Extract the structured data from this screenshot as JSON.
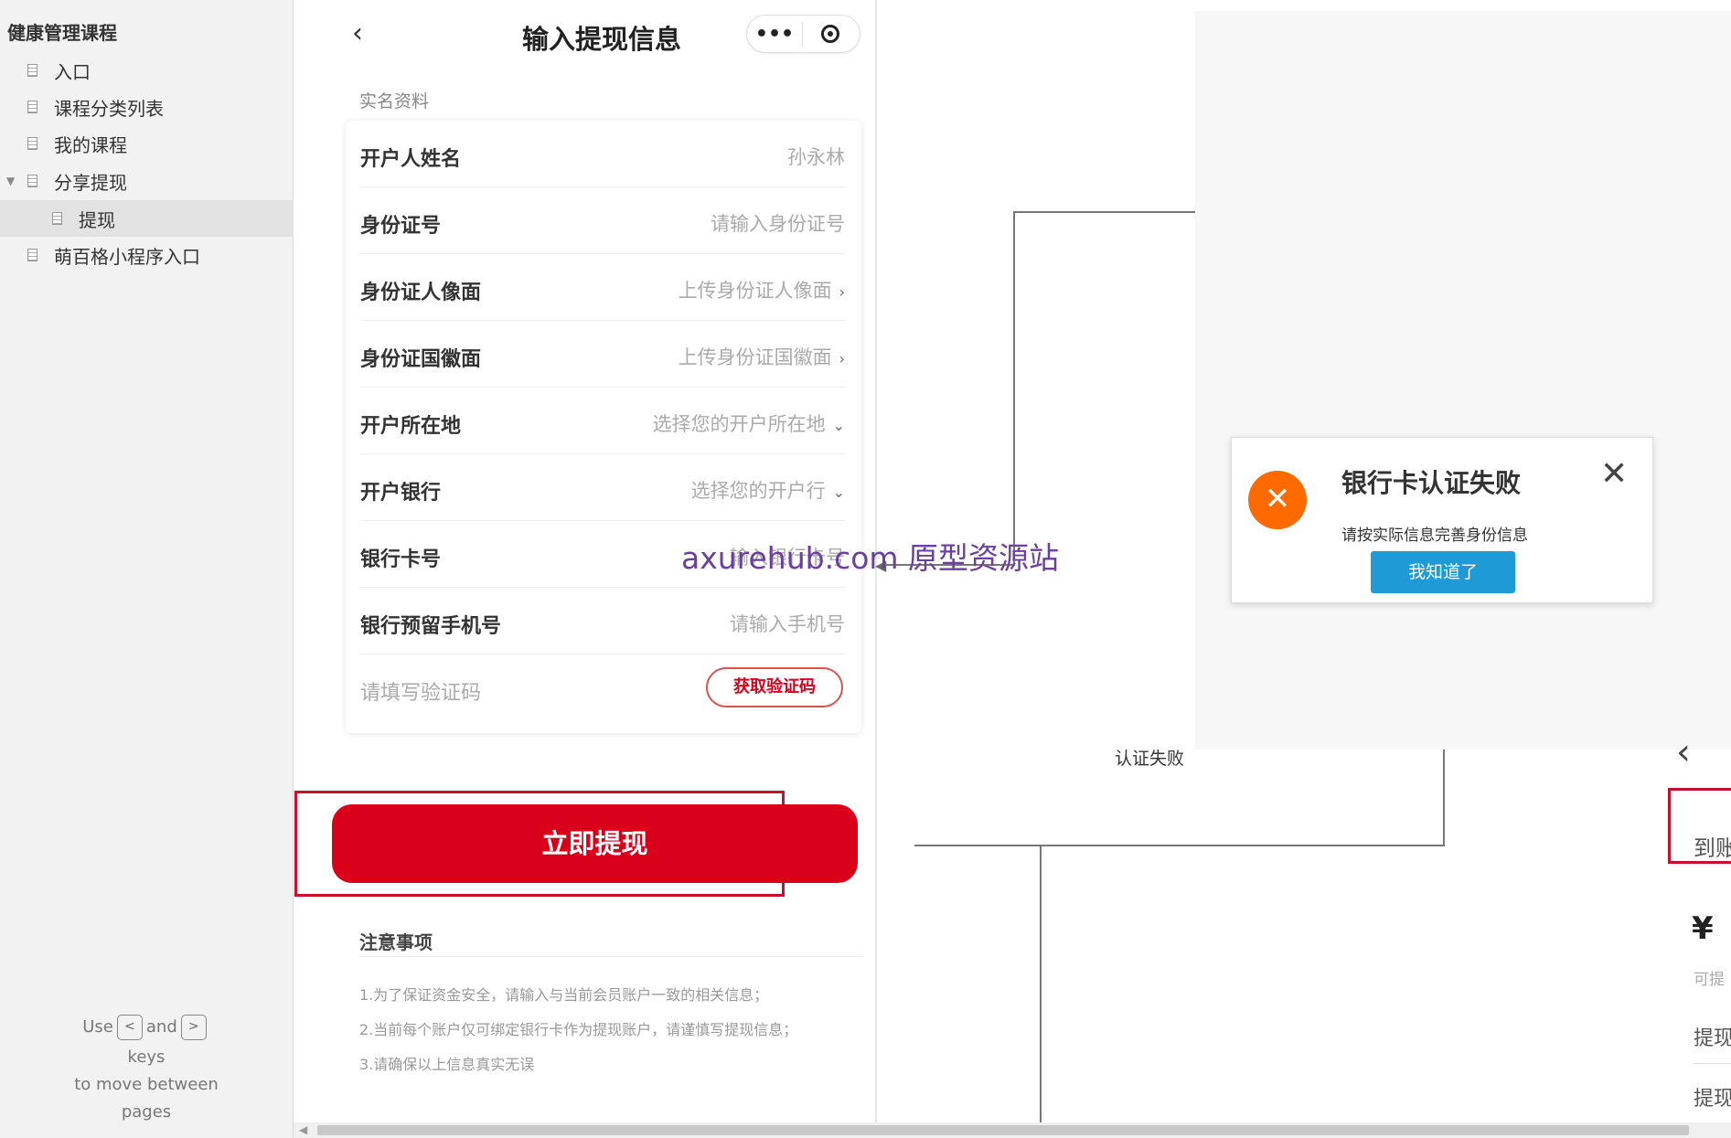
{
  "sidebar": {
    "project_title": "健康管理课程",
    "items": [
      {
        "label": "入口"
      },
      {
        "label": "课程分类列表"
      },
      {
        "label": "我的课程"
      },
      {
        "label": "分享提现",
        "expanded": true
      },
      {
        "label": "提现",
        "selected": true
      },
      {
        "label": "萌百格小程序入口"
      }
    ],
    "hint": {
      "use": "Use",
      "and": "and",
      "keys": "keys",
      "line2": "to move between",
      "line3": "pages",
      "prev_key": "<",
      "next_key": ">"
    }
  },
  "phone": {
    "title": "输入提现信息",
    "capsule_more": "•••",
    "section_label": "实名资料",
    "fields": [
      {
        "label": "开户人姓名",
        "value": "孙永林",
        "icon": ""
      },
      {
        "label": "身份证号",
        "value": "请输入身份证号",
        "icon": ""
      },
      {
        "label": "身份证人像面",
        "value": "上传身份证人像面",
        "icon": "›"
      },
      {
        "label": "身份证国徽面",
        "value": "上传身份证国徽面",
        "icon": "›"
      },
      {
        "label": "开户所在地",
        "value": "选择您的开户所在地",
        "icon": "⌄"
      },
      {
        "label": "开户银行",
        "value": "选择您的开户行",
        "icon": "⌄"
      },
      {
        "label": "银行卡号",
        "value": "输入银行卡号",
        "icon": ""
      },
      {
        "label": "银行预留手机号",
        "value": "请输入手机号",
        "icon": ""
      }
    ],
    "code_placeholder": "请填写验证码",
    "code_button": "获取验证码",
    "withdraw_button": "立即提现",
    "notes_title": "注意事项",
    "notes": [
      "1.为了保证资金安全，请输入与当前会员账户一致的相关信息；",
      "2.当前每个账户仅可绑定银行卡作为提现账户，请谨慎写提现信息；",
      "3.请确保以上信息真实无误"
    ]
  },
  "fail_dialog": {
    "title": "银行卡认证失败",
    "message": "请按实际信息完善身份信息",
    "ok_button": "我知道了",
    "icon": "error-x-icon"
  },
  "connector_label": "认证失败",
  "watermark": "axurehub.com 原型资源站",
  "right_clipped": {
    "box_text": "到账",
    "currency": "¥",
    "sub_text": "可提",
    "row1": "提现",
    "row2": "提现"
  },
  "colors": {
    "primary_red": "#d9001b",
    "dialog_button_blue": "#1e9bd7",
    "error_orange": "#ff6a00",
    "highlight_border": "#c8102e"
  }
}
